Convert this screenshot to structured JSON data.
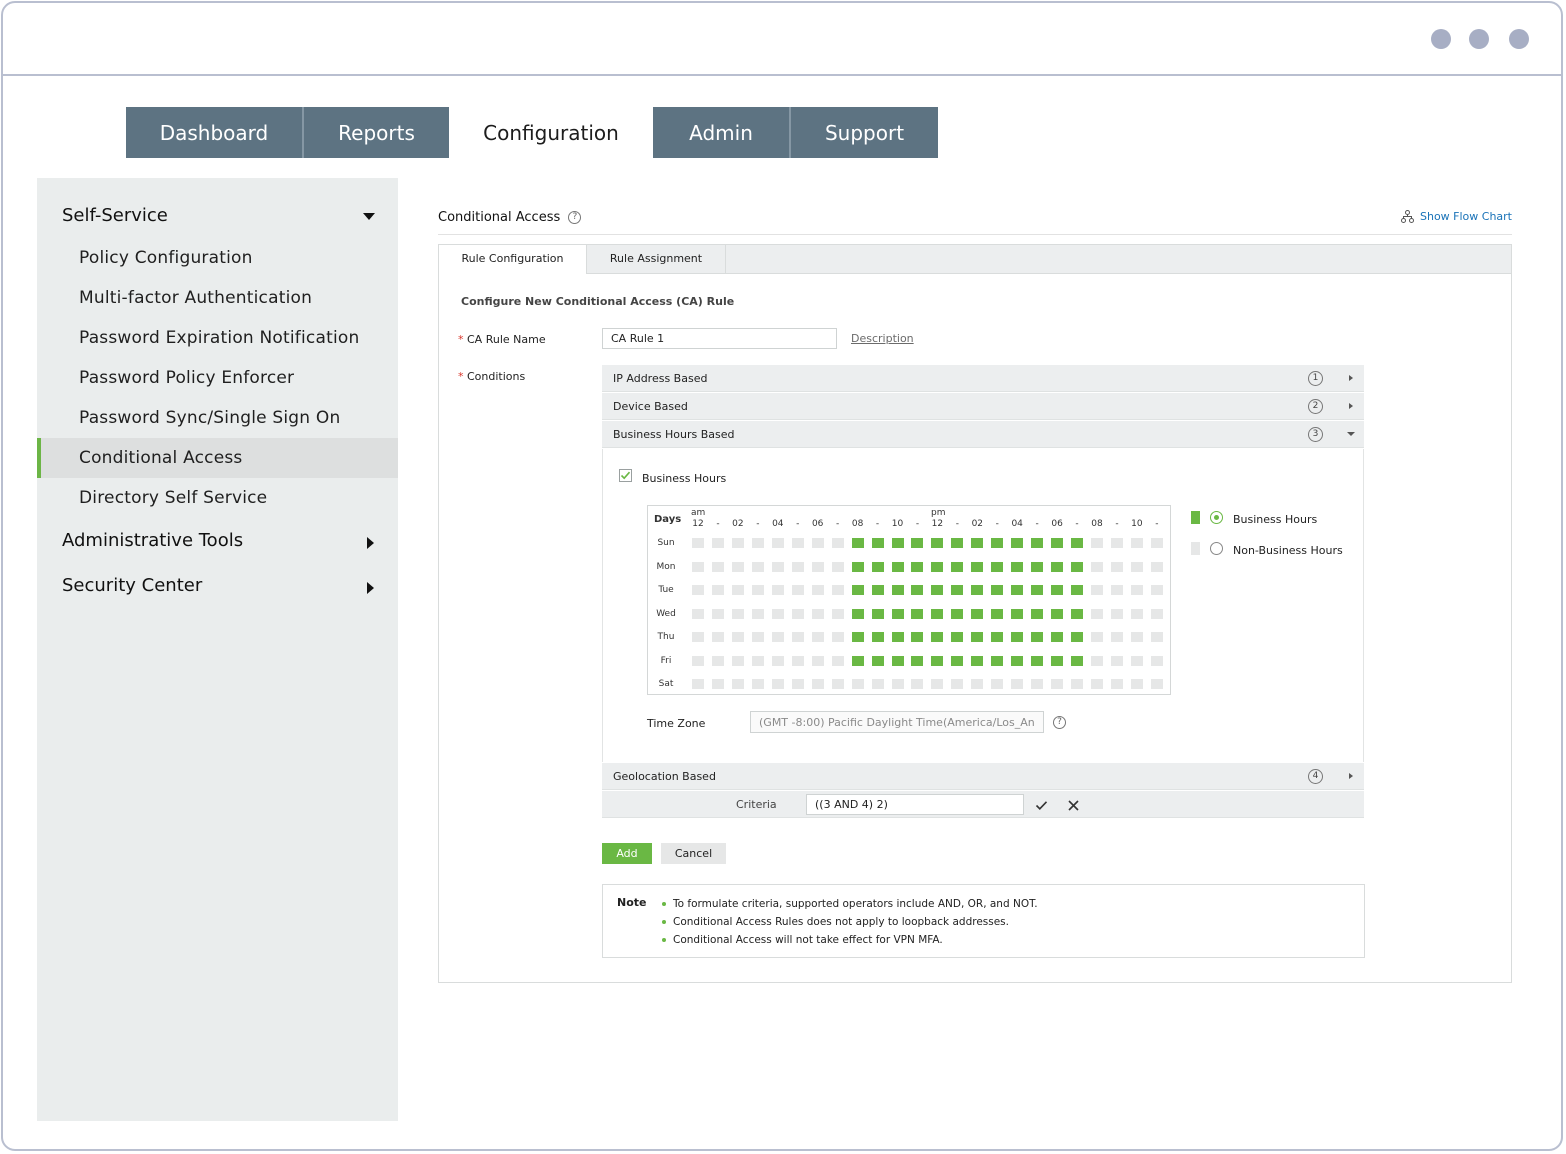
{
  "nav_tabs": [
    {
      "label": "Dashboard",
      "active": false
    },
    {
      "label": "Reports",
      "active": false
    },
    {
      "label": "Configuration",
      "active": true
    },
    {
      "label": "Admin",
      "active": false
    },
    {
      "label": "Support",
      "active": false
    }
  ],
  "sidebar": {
    "self_service": {
      "label": "Self-Service",
      "items": [
        {
          "label": "Policy Configuration"
        },
        {
          "label": "Multi-factor Authentication"
        },
        {
          "label": "Password Expiration Notification"
        },
        {
          "label": "Password Policy Enforcer"
        },
        {
          "label": "Password Sync/Single Sign On"
        },
        {
          "label": "Conditional Access",
          "active": true
        },
        {
          "label": "Directory Self Service"
        }
      ]
    },
    "admin_tools": {
      "label": "Administrative Tools"
    },
    "security_center": {
      "label": "Security Center"
    }
  },
  "header": {
    "title": "Conditional Access",
    "flow_chart_link": "Show Flow Chart",
    "help_glyph": "?"
  },
  "subtabs": [
    {
      "label": "Rule Configuration",
      "active": true
    },
    {
      "label": "Rule Assignment",
      "active": false
    }
  ],
  "form": {
    "heading": "Configure New Conditional Access (CA) Rule",
    "required_mark": "*",
    "rule_name_label": "CA Rule Name",
    "rule_name_value": "CA Rule 1",
    "description_link": "Description",
    "conditions_label": "Conditions"
  },
  "conditions": [
    {
      "label": "IP Address Based",
      "number": "1",
      "expanded": false
    },
    {
      "label": "Device Based",
      "number": "2",
      "expanded": false
    },
    {
      "label": "Business Hours Based",
      "number": "3",
      "expanded": true
    },
    {
      "label": "Geolocation Based",
      "number": "4",
      "expanded": false
    }
  ],
  "business_hours": {
    "checkbox_label": "Business Hours",
    "checked": true,
    "days_header": "Days",
    "am_label": "am",
    "pm_label": "pm",
    "hour_labels": [
      "12",
      "-",
      "02",
      "-",
      "04",
      "-",
      "06",
      "-",
      "08",
      "-",
      "10",
      "-",
      "12",
      "-",
      "02",
      "-",
      "04",
      "-",
      "06",
      "-",
      "08",
      "-",
      "10",
      "-"
    ],
    "days": [
      "Sun",
      "Mon",
      "Tue",
      "Wed",
      "Thu",
      "Fri",
      "Sat"
    ],
    "schedule": [
      [
        0,
        0,
        0,
        0,
        0,
        0,
        0,
        0,
        1,
        1,
        1,
        1,
        1,
        1,
        1,
        1,
        1,
        1,
        1,
        1,
        0,
        0,
        0,
        0
      ],
      [
        0,
        0,
        0,
        0,
        0,
        0,
        0,
        0,
        1,
        1,
        1,
        1,
        1,
        1,
        1,
        1,
        1,
        1,
        1,
        1,
        0,
        0,
        0,
        0
      ],
      [
        0,
        0,
        0,
        0,
        0,
        0,
        0,
        0,
        1,
        1,
        1,
        1,
        1,
        1,
        1,
        1,
        1,
        1,
        1,
        1,
        0,
        0,
        0,
        0
      ],
      [
        0,
        0,
        0,
        0,
        0,
        0,
        0,
        0,
        1,
        1,
        1,
        1,
        1,
        1,
        1,
        1,
        1,
        1,
        1,
        1,
        0,
        0,
        0,
        0
      ],
      [
        0,
        0,
        0,
        0,
        0,
        0,
        0,
        0,
        1,
        1,
        1,
        1,
        1,
        1,
        1,
        1,
        1,
        1,
        1,
        1,
        0,
        0,
        0,
        0
      ],
      [
        0,
        0,
        0,
        0,
        0,
        0,
        0,
        0,
        1,
        1,
        1,
        1,
        1,
        1,
        1,
        1,
        1,
        1,
        1,
        1,
        0,
        0,
        0,
        0
      ],
      [
        0,
        0,
        0,
        0,
        0,
        0,
        0,
        0,
        0,
        0,
        0,
        0,
        0,
        0,
        0,
        0,
        0,
        0,
        0,
        0,
        0,
        0,
        0,
        0
      ]
    ],
    "legend": {
      "business": "Business Hours",
      "non_business": "Non-Business Hours",
      "selected": "business"
    },
    "timezone_label": "Time Zone",
    "timezone_value": "(GMT -8:00) Pacific Daylight Time(America/Los_An"
  },
  "criteria": {
    "label": "Criteria",
    "value": "((3 AND 4) 2)"
  },
  "buttons": {
    "add": "Add",
    "cancel": "Cancel"
  },
  "note": {
    "title": "Note",
    "items": [
      "To formulate criteria, supported operators include AND, OR, and NOT.",
      "Conditional Access Rules does not apply to loopback addresses.",
      "Conditional Access will not take effect for VPN MFA."
    ]
  },
  "colors": {
    "nav_tab_bg": "#5d7382",
    "business_green": "#6ab844",
    "non_business_gray": "#e6e7e7",
    "link_blue": "#1a73b8",
    "required_red": "#d9362b"
  }
}
